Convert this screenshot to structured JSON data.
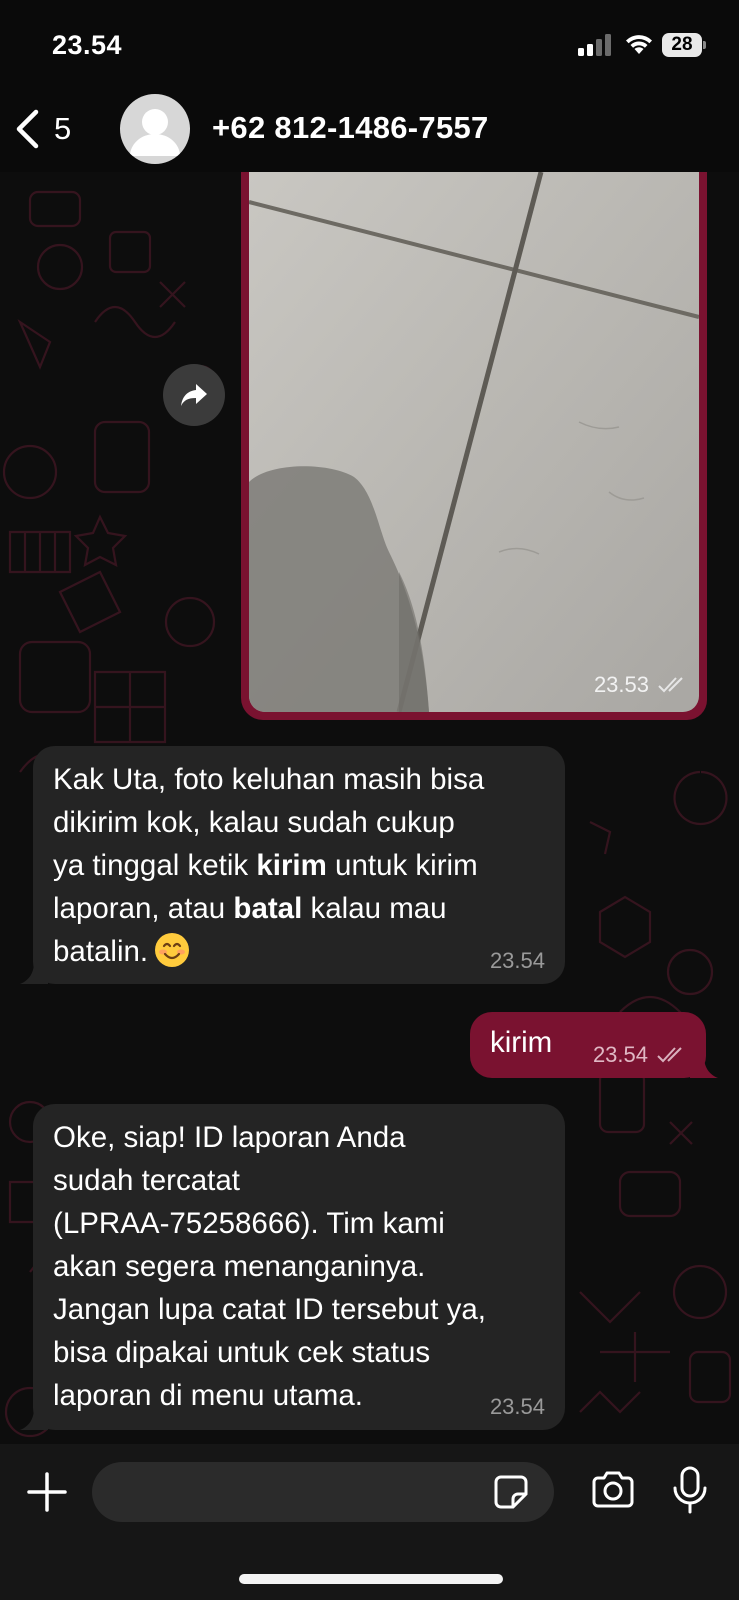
{
  "status_bar": {
    "time": "23.54",
    "battery": "28"
  },
  "header": {
    "back_count": "5",
    "contact_name": "+62 812-1486-7557"
  },
  "image_message": {
    "time": "23.53"
  },
  "messages": [
    {
      "direction": "incoming",
      "lines": [
        [
          "Kak Uta, foto keluhan masih bisa"
        ],
        [
          "dikirim kok,  kalau sudah cukup"
        ],
        [
          "ya tinggal ketik ",
          "kirim",
          " untuk kirim"
        ],
        [
          "laporan, atau ",
          "batal",
          " kalau mau"
        ],
        [
          "batalin."
        ]
      ],
      "time": "23.54"
    },
    {
      "direction": "outgoing",
      "text": "kirim",
      "time": "23.54"
    },
    {
      "direction": "incoming",
      "lines": [
        "Oke, siap!  ID laporan Anda",
        "sudah tercatat",
        "(LPRAA-75258666).  Tim kami",
        "akan segera menanganinya.",
        "Jangan lupa catat ID tersebut ya,",
        "bisa dipakai untuk cek status",
        "laporan di menu utama."
      ],
      "time": "23.54"
    }
  ],
  "input": {
    "placeholder": ""
  },
  "colors": {
    "outgoing_bubble": "#7a1230",
    "incoming_bubble": "#242424",
    "background": "#0b0b0b"
  },
  "icons": [
    "back-chevron-icon",
    "avatar-icon",
    "forward-icon",
    "double-check-icon",
    "plus-icon",
    "sticker-icon",
    "camera-icon",
    "microphone-icon",
    "signal-icon",
    "wifi-icon",
    "battery-icon"
  ]
}
